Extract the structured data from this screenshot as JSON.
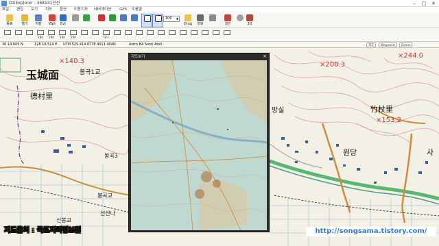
{
  "window": {
    "title": "OziExplorer - 368141선산"
  },
  "menu": {
    "items": [
      "파일",
      "편집",
      "보기",
      "지도",
      "옵션",
      "이동지도",
      "네비게이션",
      "GPS",
      "도움말"
    ]
  },
  "toolbar1": {
    "buttons": [
      {
        "label": "종료",
        "icon": "exit-icon"
      },
      {
        "label": "열기",
        "icon": "open-map-icon"
      },
      {
        "label": "저장",
        "icon": "save-icon"
      },
      {
        "label": "Wpt",
        "icon": "waypoint-icon"
      },
      {
        "label": "Evt",
        "icon": "event-icon"
      },
      {
        "label": "",
        "icon": "track-icon"
      },
      {
        "label": "",
        "icon": "route-icon"
      },
      {
        "label": "",
        "icon": "gps-icon"
      },
      {
        "label": "",
        "icon": "layers-icon"
      },
      {
        "label": "",
        "icon": "zoom-in-icon"
      },
      {
        "label": "",
        "icon": "zoom-out-icon"
      },
      {
        "label": "",
        "icon": "zoom-icon"
      },
      {
        "label": "",
        "icon": "fit-icon"
      },
      {
        "label": "Drag",
        "icon": "drag-icon"
      },
      {
        "label": "정보",
        "icon": "info-icon"
      },
      {
        "label": "",
        "icon": "grid-icon"
      },
      {
        "label": "색인",
        "icon": "index-icon"
      },
      {
        "label": "",
        "icon": "target-icon"
      },
      {
        "label": "3D",
        "icon": "3d-icon"
      }
    ],
    "zoom_value": "100"
  },
  "toolbar2": {
    "labels": [
      "",
      "",
      "",
      "200",
      "200",
      "200",
      "200",
      "",
      "",
      "OFF",
      "",
      "",
      "",
      "",
      "",
      "",
      "",
      "",
      "",
      "",
      ""
    ]
  },
  "status": {
    "latlon": "36 14.605 N",
    "lon": "128 16.514 E",
    "utm": "UTM  52S  414 877E  4011 404N",
    "datum": "Astro B4 Sorol Atoll",
    "chips": [
      "지도",
      "Waypoint",
      "Event"
    ]
  },
  "map": {
    "place_labels": [
      {
        "text": "玉城面",
        "size": 16,
        "bold": true
      },
      {
        "text": "德村里",
        "size": 11,
        "bold": false
      },
      {
        "text": "봉곡1교",
        "size": 9,
        "bold": false
      },
      {
        "text": "봉곡3",
        "size": 8,
        "bold": false
      },
      {
        "text": "봉곡교",
        "size": 8,
        "bold": false
      },
      {
        "text": "신봉교",
        "size": 8,
        "bold": false
      },
      {
        "text": "선산나",
        "size": 8,
        "bold": false
      },
      {
        "text": "방실",
        "size": 10,
        "bold": false
      },
      {
        "text": "竹杖里",
        "size": 11,
        "bold": false
      },
      {
        "text": "원당",
        "size": 11,
        "bold": false
      },
      {
        "text": "사",
        "size": 11,
        "bold": false
      }
    ],
    "elevations": [
      "×140.3",
      "×200.3",
      "×244.0",
      "×153.2"
    ]
  },
  "popup": {
    "title": "지도보기",
    "close": "×"
  },
  "credit": "지도출처 : 국토지리정보원",
  "watermark": "http://songsama.tistory.com/"
}
